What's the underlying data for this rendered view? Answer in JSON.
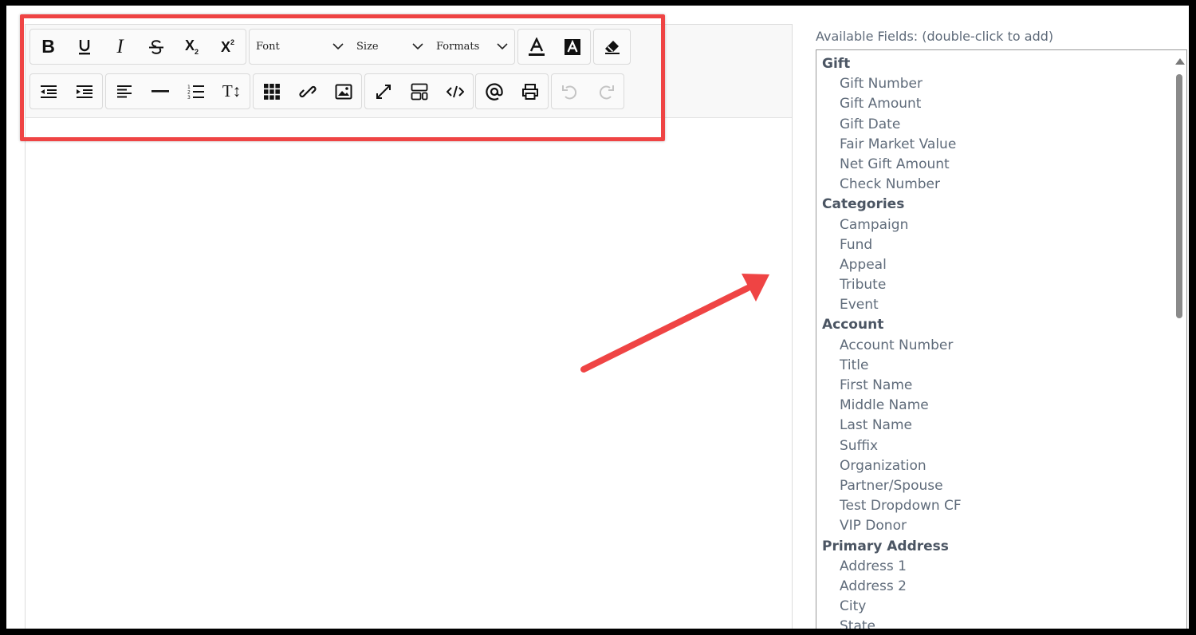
{
  "toolbar": {
    "dropdowns": {
      "font": "Font",
      "size": "Size",
      "formats": "Formats"
    },
    "glyphs": {
      "bold": "B",
      "italic": "I",
      "subscript_base": "X",
      "subscript_mark": "2",
      "superscript_base": "X",
      "superscript_mark": "2",
      "text_size": "T↕"
    }
  },
  "fields_panel": {
    "title": "Available Fields: (double-click to add)",
    "groups": [
      {
        "label": "Gift",
        "items": [
          "Gift Number",
          "Gift Amount",
          "Gift Date",
          "Fair Market Value",
          "Net Gift Amount",
          "Check Number"
        ]
      },
      {
        "label": "Categories",
        "items": [
          "Campaign",
          "Fund",
          "Appeal",
          "Tribute",
          "Event"
        ]
      },
      {
        "label": "Account",
        "items": [
          "Account Number",
          "Title",
          "First Name",
          "Middle Name",
          "Last Name",
          "Suffix",
          "Organization",
          "Partner/Spouse",
          "Test Dropdown CF",
          "VIP Donor"
        ]
      },
      {
        "label": "Primary Address",
        "items": [
          "Address 1",
          "Address 2",
          "City",
          "State"
        ]
      }
    ]
  },
  "colors": {
    "highlight": "#ef4444",
    "field_text": "#5f6b7a",
    "group_text": "#4b5563"
  }
}
